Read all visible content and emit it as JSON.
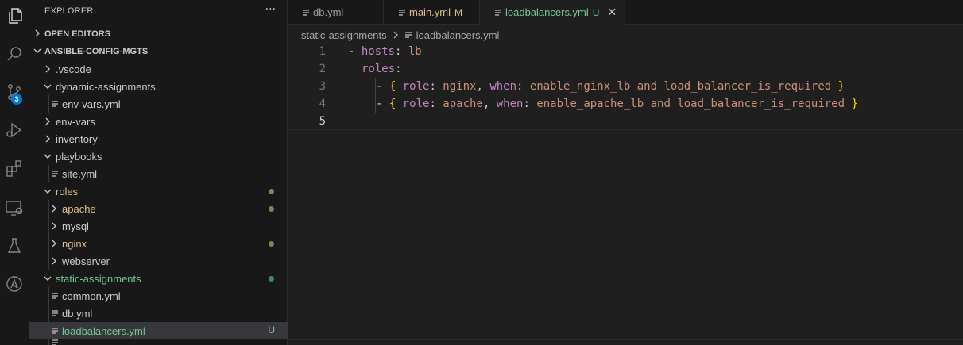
{
  "explorer": {
    "title": "EXPLORER",
    "more": "···",
    "open_editors": "OPEN EDITORS",
    "project": "ANSIBLE-CONFIG-MGTS",
    "items": [
      {
        "label": ".vscode",
        "kind": "folder",
        "expanded": false
      },
      {
        "label": "dynamic-assignments",
        "kind": "folder",
        "expanded": true
      },
      {
        "label": "env-vars.yml",
        "kind": "file"
      },
      {
        "label": "env-vars",
        "kind": "folder",
        "expanded": false
      },
      {
        "label": "inventory",
        "kind": "folder",
        "expanded": false
      },
      {
        "label": "playbooks",
        "kind": "folder",
        "expanded": true
      },
      {
        "label": "site.yml",
        "kind": "file"
      },
      {
        "label": "roles",
        "kind": "folder",
        "expanded": true,
        "status": "modified"
      },
      {
        "label": "apache",
        "kind": "folder",
        "expanded": false,
        "status": "modified"
      },
      {
        "label": "mysql",
        "kind": "folder",
        "expanded": false
      },
      {
        "label": "nginx",
        "kind": "folder",
        "expanded": false,
        "status": "modified"
      },
      {
        "label": "webserver",
        "kind": "folder",
        "expanded": false
      },
      {
        "label": "static-assignments",
        "kind": "folder",
        "expanded": true,
        "status": "untracked"
      },
      {
        "label": "common.yml",
        "kind": "file"
      },
      {
        "label": "db.yml",
        "kind": "file"
      },
      {
        "label": "loadbalancers.yml",
        "kind": "file",
        "status": "untracked",
        "badge": "U",
        "selected": true
      }
    ]
  },
  "activity_bar": {
    "source_control_badge": "3",
    "icons": [
      "files-icon",
      "search-icon",
      "source-control-icon",
      "run-debug-icon",
      "extensions-icon",
      "remote-explorer-icon",
      "testing-icon",
      "ansible-icon"
    ]
  },
  "tabs": [
    {
      "label": "db.yml",
      "flag": ""
    },
    {
      "label": "main.yml",
      "flag": "M"
    },
    {
      "label": "loadbalancers.yml",
      "flag": "U",
      "close": "✕"
    }
  ],
  "breadcrumb": {
    "folder": "static-assignments",
    "file": "loadbalancers.yml"
  },
  "editor": {
    "line_numbers": [
      "1",
      "2",
      "3",
      "4",
      "5"
    ],
    "lines": {
      "l1": {
        "dash": "- ",
        "key": "hosts",
        "colon": ": ",
        "value": "lb"
      },
      "l2": {
        "key": "roles",
        "colon": ":"
      },
      "l3": {
        "dash": "- ",
        "open": "{ ",
        "k1": "role",
        "c1": ": ",
        "v1": "nginx",
        "comma": ", ",
        "k2": "when",
        "c2": ": ",
        "v2": "enable_nginx_lb and load_balancer_is_required",
        "close": " }"
      },
      "l4": {
        "dash": "- ",
        "open": "{ ",
        "k1": "role",
        "c1": ": ",
        "v1": "apache",
        "comma": ", ",
        "k2": "when",
        "c2": ": ",
        "v2": "enable_apache_lb and load_balancer_is_required",
        "close": " }"
      }
    }
  },
  "colors": {
    "key": "#c586c0",
    "value": "#ce9178",
    "bracket": "#ffd700",
    "modified": "#e2c08d",
    "untracked": "#73c991"
  }
}
